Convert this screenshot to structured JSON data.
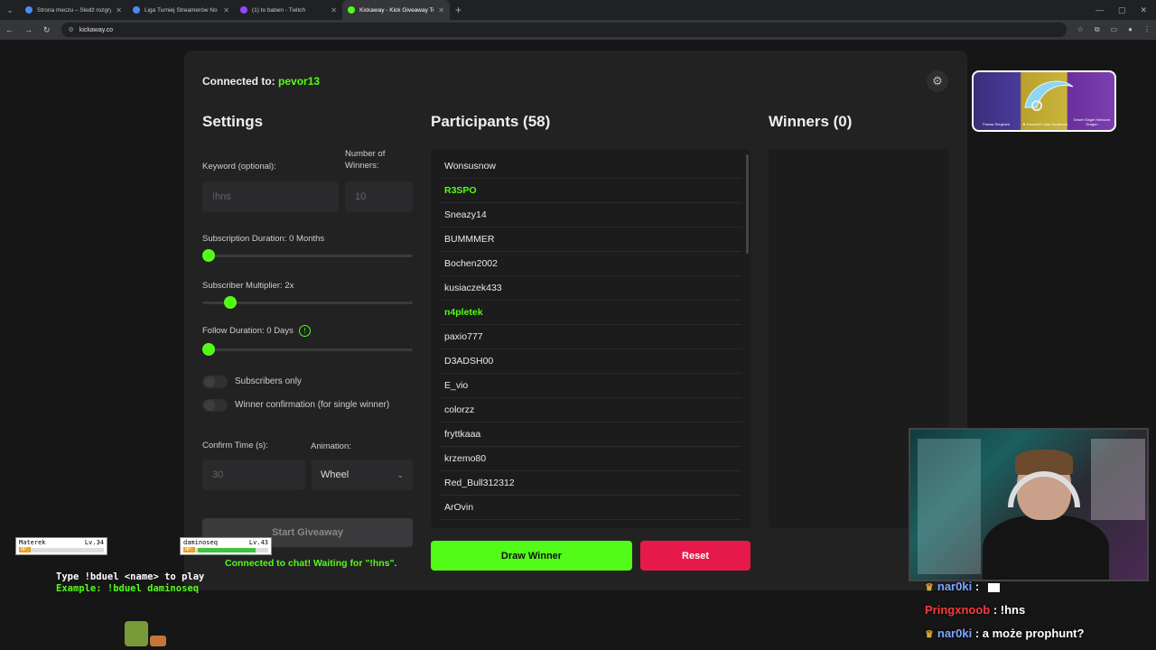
{
  "browser": {
    "tabs": [
      {
        "title": "Strona meczu – Śledź rozgrywki",
        "favicon_color": "#4a8af4",
        "active": false
      },
      {
        "title": "Liga Turniej Streamerów No Bu",
        "favicon_color": "#4a8af4",
        "active": false
      },
      {
        "title": "(1) to baben - Twitch",
        "favicon_color": "#9146ff",
        "active": false
      },
      {
        "title": "Kickaway - Kick Giveaway Tool",
        "favicon_color": "#53fc18",
        "active": true
      }
    ],
    "url": "kickaway.co"
  },
  "header": {
    "connected_label": "Connected to:",
    "username": "pevor13"
  },
  "settings": {
    "title": "Settings",
    "keyword_label": "Keyword (optional):",
    "keyword_placeholder": "!hns",
    "winners_label": "Number of Winners:",
    "winners_placeholder": "10",
    "sub_duration_label": "Subscription Duration: 0 Months",
    "sub_duration_level": 0,
    "sub_multiplier_label": "Subscriber Multiplier: 2x",
    "sub_multiplier_level": 0.11,
    "follow_duration_label": "Follow Duration: 0 Days",
    "follow_duration_level": 0,
    "subscribers_only_label": "Subscribers only",
    "winner_confirmation_label": "Winner confirmation (for single winner)",
    "confirm_time_label": "Confirm Time (s):",
    "confirm_time_placeholder": "30",
    "animation_label": "Animation:",
    "animation_value": "Wheel",
    "start_button": "Start Giveaway",
    "status": "Connected to chat! Waiting for \"!hns\"."
  },
  "participants": {
    "title": "Participants (58)",
    "list": [
      {
        "name": "Wonsusnow",
        "highlight": false
      },
      {
        "name": "R3SPO",
        "highlight": true
      },
      {
        "name": "Sneazy14",
        "highlight": false
      },
      {
        "name": "BUMMMER",
        "highlight": false
      },
      {
        "name": "Bochen2002",
        "highlight": false
      },
      {
        "name": "kusiaczek433",
        "highlight": false
      },
      {
        "name": "n4pletek",
        "highlight": true
      },
      {
        "name": "paxio777",
        "highlight": false
      },
      {
        "name": "D3ADSH00",
        "highlight": false
      },
      {
        "name": "E_vio",
        "highlight": false
      },
      {
        "name": "colorzz",
        "highlight": false
      },
      {
        "name": "fryttkaaa",
        "highlight": false
      },
      {
        "name": "krzemo80",
        "highlight": false
      },
      {
        "name": "Red_Bull312312",
        "highlight": false
      },
      {
        "name": "ArOvin",
        "highlight": false
      }
    ],
    "draw_button": "Draw Winner",
    "reset_button": "Reset"
  },
  "winners": {
    "title": "Winners (0)"
  },
  "overlay": {
    "skin_captions": [
      "Famas\nSergeant",
      "★ Karambit\nCase Hardened",
      "Desert Eagle\nHeirloom Dragon"
    ],
    "chat": [
      {
        "name": "nar0ki",
        "text": ":",
        "has_crown": true
      },
      {
        "name": "Pringxnoob",
        "text": ": !hns",
        "has_crown": false
      },
      {
        "name": "nar0ki",
        "text": ": a może prophunt?",
        "has_crown": true
      }
    ],
    "duel": {
      "player1": {
        "name": "Materek",
        "level": "Lv.34"
      },
      "player2": {
        "name": "daminoseq",
        "level": "Lv.43"
      },
      "hp_label": "HP:",
      "line1": "Type !bduel <name> to play",
      "line2": "Example: !bduel daminoseq"
    }
  },
  "colors": {
    "accent": "#53fc18",
    "reset": "#e6194b",
    "panel": "#222223"
  }
}
